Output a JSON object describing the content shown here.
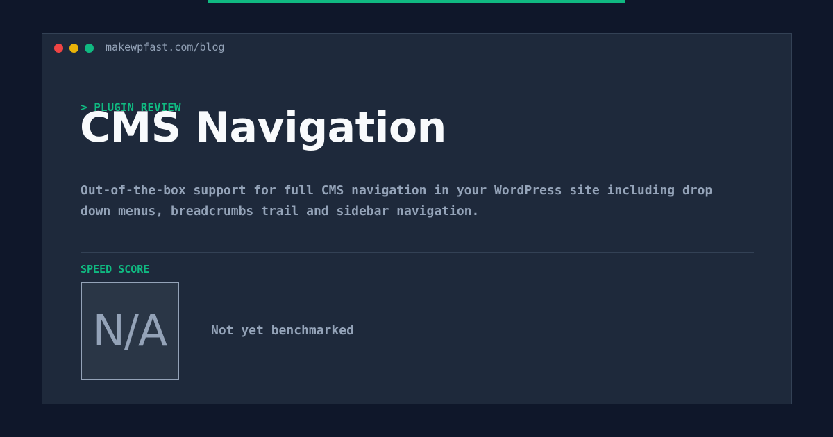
{
  "browser": {
    "url": "makewpfast.com/blog"
  },
  "article": {
    "eyebrow": "> PLUGIN REVIEW",
    "title": "CMS Navigation",
    "description": "Out-of-the-box support for full CMS navigation in your WordPress site including drop down menus, breadcrumbs trail and sidebar navigation."
  },
  "speed": {
    "label": "SPEED SCORE",
    "value": "N/A",
    "note": "Not yet benchmarked"
  },
  "colors": {
    "background": "#0f172a",
    "panel": "#1e293b",
    "accent": "#10b981",
    "muted_text": "#94a3b8",
    "title_text": "#f8fafc",
    "close_dot": "#ef4444",
    "minimize_dot": "#eab308",
    "maximize_dot": "#10b981"
  }
}
